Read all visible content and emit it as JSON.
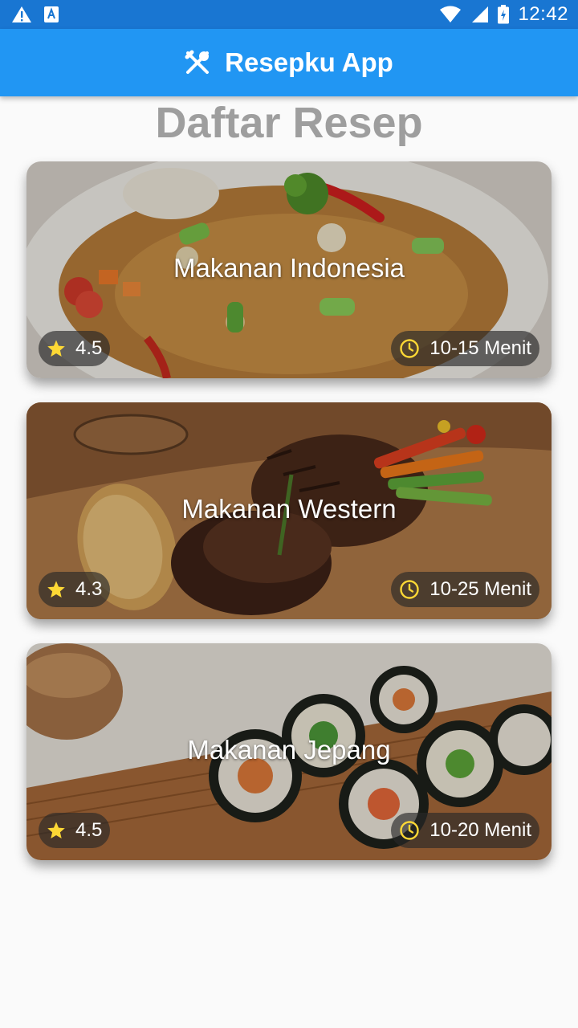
{
  "status_bar": {
    "time": "12:42",
    "icons": [
      "warning-icon",
      "text-icon",
      "wifi-icon",
      "signal-icon",
      "battery-icon"
    ]
  },
  "app_bar": {
    "title": "Resepku App",
    "icon": "utensils-icon"
  },
  "page": {
    "title": "Daftar Resep"
  },
  "recipes": [
    {
      "name": "Makanan Indonesia",
      "rating": "4.5",
      "duration": "10-15 Menit"
    },
    {
      "name": "Makanan Western",
      "rating": "4.3",
      "duration": "10-25 Menit"
    },
    {
      "name": "Makanan Jepang",
      "rating": "4.5",
      "duration": "10-20 Menit"
    }
  ],
  "colors": {
    "status_bar": "#1976d2",
    "app_bar": "#2196f3",
    "title_gray": "#9e9e9e",
    "accent_yellow": "#fdd835"
  }
}
